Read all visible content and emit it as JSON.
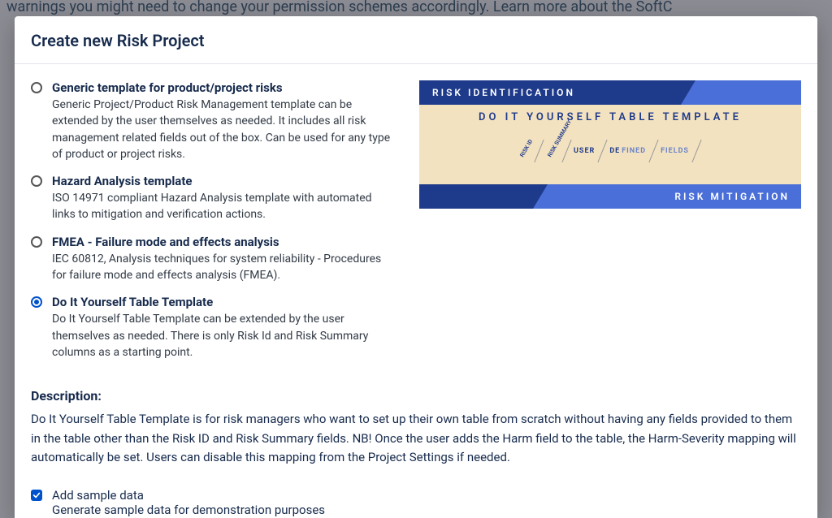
{
  "background_text": "warnings you might need to change your permission schemes accordingly. Learn more about the SoftC",
  "modal": {
    "title": "Create new Risk Project"
  },
  "options": [
    {
      "title": "Generic template for product/project risks",
      "desc": "Generic Project/Product Risk Management template can be extended by the user themselves as needed. It includes all risk management related fields out of the box. Can be used for any type of product or project risks.",
      "selected": false
    },
    {
      "title": "Hazard Analysis template",
      "desc": "ISO 14971 compliant Hazard Analysis template with automated links to mitigation and verification actions.",
      "selected": false
    },
    {
      "title": "FMEA - Failure mode and effects analysis",
      "desc": "IEC 60812, Analysis techniques for system reliability - Procedures for failure mode and effects analysis (FMEA).",
      "selected": false
    },
    {
      "title": "Do It Yourself Table Template",
      "desc": "Do It Yourself Table Template can be extended by the user themselves as needed. There is only Risk Id and Risk Summary columns as a starting point.",
      "selected": true
    }
  ],
  "preview": {
    "top_label": "RISK IDENTIFICATION",
    "mid_title": "DO IT YOURSELF TABLE TEMPLATE",
    "mid_small_labels": [
      "RISK ID",
      "RISK SUMMARY"
    ],
    "mid_word1": "USER",
    "mid_word2_part1": "DE",
    "mid_word2_part2": "FINED",
    "mid_word3": "FIELDS",
    "bottom_label": "RISK MITIGATION"
  },
  "description": {
    "heading": "Description:",
    "text": "Do It Yourself Table Template is for risk managers who want to set up their own table from scratch without having any fields provided to them in the table other than the Risk ID and Risk Summary fields. NB! Once the user adds the Harm field to the table, the Harm-Severity mapping will automatically be set. Users can disable this mapping from the Project Settings if needed."
  },
  "sample": {
    "label": "Add sample data",
    "desc": "Generate sample data for demonstration purposes",
    "checked": true
  }
}
